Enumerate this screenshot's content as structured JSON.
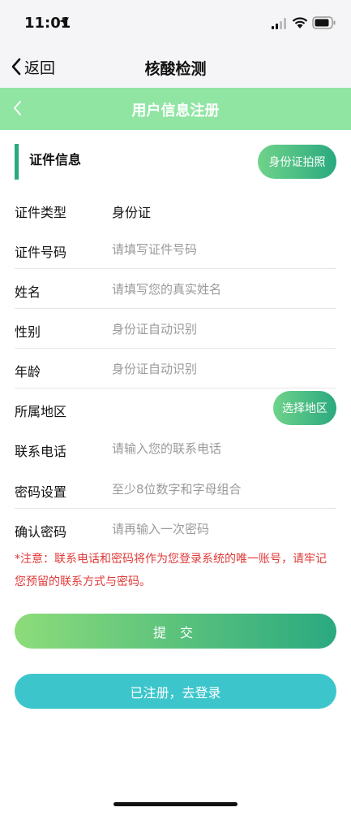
{
  "status_bar": {
    "time": "11:01"
  },
  "nav": {
    "back_label": "返回",
    "title": "核酸检测"
  },
  "header": {
    "title": "用户信息注册"
  },
  "section": {
    "title": "证件信息",
    "id_photo_button": "身份证拍照"
  },
  "form": {
    "id_type": {
      "label": "证件类型",
      "value": "身份证"
    },
    "id_number": {
      "label": "证件号码",
      "placeholder": "请填写证件号码"
    },
    "name": {
      "label": "姓名",
      "placeholder": "请填写您的真实姓名"
    },
    "gender": {
      "label": "性别",
      "placeholder": "身份证自动识别"
    },
    "age": {
      "label": "年龄",
      "placeholder": "身份证自动识别"
    },
    "region": {
      "label": "所属地区",
      "button": "选择地区"
    },
    "phone": {
      "label": "联系电话",
      "placeholder": "请输入您的联系电话"
    },
    "password": {
      "label": "密码设置",
      "placeholder": "至少8位数字和字母组合"
    },
    "confirm_password": {
      "label": "确认密码",
      "placeholder": "请再输入一次密码"
    }
  },
  "notice": "*注意：联系电话和密码将作为您登录系统的唯一账号，请牢记您预留的联系方式与密码。",
  "buttons": {
    "submit": "提 交",
    "login": "已注册，去登录"
  },
  "colors": {
    "header_green": "#90e5a3",
    "accent_green": "#2aa97f",
    "login_teal": "#3cc6cc",
    "notice_red": "#e03a3a"
  }
}
